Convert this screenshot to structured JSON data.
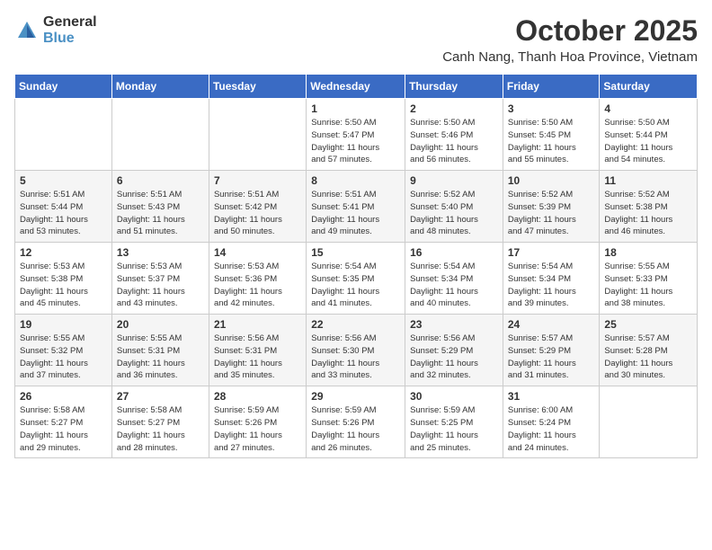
{
  "header": {
    "logo_general": "General",
    "logo_blue": "Blue",
    "month": "October 2025",
    "location": "Canh Nang, Thanh Hoa Province, Vietnam"
  },
  "weekdays": [
    "Sunday",
    "Monday",
    "Tuesday",
    "Wednesday",
    "Thursday",
    "Friday",
    "Saturday"
  ],
  "weeks": [
    [
      {
        "day": "",
        "info": ""
      },
      {
        "day": "",
        "info": ""
      },
      {
        "day": "",
        "info": ""
      },
      {
        "day": "1",
        "info": "Sunrise: 5:50 AM\nSunset: 5:47 PM\nDaylight: 11 hours\nand 57 minutes."
      },
      {
        "day": "2",
        "info": "Sunrise: 5:50 AM\nSunset: 5:46 PM\nDaylight: 11 hours\nand 56 minutes."
      },
      {
        "day": "3",
        "info": "Sunrise: 5:50 AM\nSunset: 5:45 PM\nDaylight: 11 hours\nand 55 minutes."
      },
      {
        "day": "4",
        "info": "Sunrise: 5:50 AM\nSunset: 5:44 PM\nDaylight: 11 hours\nand 54 minutes."
      }
    ],
    [
      {
        "day": "5",
        "info": "Sunrise: 5:51 AM\nSunset: 5:44 PM\nDaylight: 11 hours\nand 53 minutes."
      },
      {
        "day": "6",
        "info": "Sunrise: 5:51 AM\nSunset: 5:43 PM\nDaylight: 11 hours\nand 51 minutes."
      },
      {
        "day": "7",
        "info": "Sunrise: 5:51 AM\nSunset: 5:42 PM\nDaylight: 11 hours\nand 50 minutes."
      },
      {
        "day": "8",
        "info": "Sunrise: 5:51 AM\nSunset: 5:41 PM\nDaylight: 11 hours\nand 49 minutes."
      },
      {
        "day": "9",
        "info": "Sunrise: 5:52 AM\nSunset: 5:40 PM\nDaylight: 11 hours\nand 48 minutes."
      },
      {
        "day": "10",
        "info": "Sunrise: 5:52 AM\nSunset: 5:39 PM\nDaylight: 11 hours\nand 47 minutes."
      },
      {
        "day": "11",
        "info": "Sunrise: 5:52 AM\nSunset: 5:38 PM\nDaylight: 11 hours\nand 46 minutes."
      }
    ],
    [
      {
        "day": "12",
        "info": "Sunrise: 5:53 AM\nSunset: 5:38 PM\nDaylight: 11 hours\nand 45 minutes."
      },
      {
        "day": "13",
        "info": "Sunrise: 5:53 AM\nSunset: 5:37 PM\nDaylight: 11 hours\nand 43 minutes."
      },
      {
        "day": "14",
        "info": "Sunrise: 5:53 AM\nSunset: 5:36 PM\nDaylight: 11 hours\nand 42 minutes."
      },
      {
        "day": "15",
        "info": "Sunrise: 5:54 AM\nSunset: 5:35 PM\nDaylight: 11 hours\nand 41 minutes."
      },
      {
        "day": "16",
        "info": "Sunrise: 5:54 AM\nSunset: 5:34 PM\nDaylight: 11 hours\nand 40 minutes."
      },
      {
        "day": "17",
        "info": "Sunrise: 5:54 AM\nSunset: 5:34 PM\nDaylight: 11 hours\nand 39 minutes."
      },
      {
        "day": "18",
        "info": "Sunrise: 5:55 AM\nSunset: 5:33 PM\nDaylight: 11 hours\nand 38 minutes."
      }
    ],
    [
      {
        "day": "19",
        "info": "Sunrise: 5:55 AM\nSunset: 5:32 PM\nDaylight: 11 hours\nand 37 minutes."
      },
      {
        "day": "20",
        "info": "Sunrise: 5:55 AM\nSunset: 5:31 PM\nDaylight: 11 hours\nand 36 minutes."
      },
      {
        "day": "21",
        "info": "Sunrise: 5:56 AM\nSunset: 5:31 PM\nDaylight: 11 hours\nand 35 minutes."
      },
      {
        "day": "22",
        "info": "Sunrise: 5:56 AM\nSunset: 5:30 PM\nDaylight: 11 hours\nand 33 minutes."
      },
      {
        "day": "23",
        "info": "Sunrise: 5:56 AM\nSunset: 5:29 PM\nDaylight: 11 hours\nand 32 minutes."
      },
      {
        "day": "24",
        "info": "Sunrise: 5:57 AM\nSunset: 5:29 PM\nDaylight: 11 hours\nand 31 minutes."
      },
      {
        "day": "25",
        "info": "Sunrise: 5:57 AM\nSunset: 5:28 PM\nDaylight: 11 hours\nand 30 minutes."
      }
    ],
    [
      {
        "day": "26",
        "info": "Sunrise: 5:58 AM\nSunset: 5:27 PM\nDaylight: 11 hours\nand 29 minutes."
      },
      {
        "day": "27",
        "info": "Sunrise: 5:58 AM\nSunset: 5:27 PM\nDaylight: 11 hours\nand 28 minutes."
      },
      {
        "day": "28",
        "info": "Sunrise: 5:59 AM\nSunset: 5:26 PM\nDaylight: 11 hours\nand 27 minutes."
      },
      {
        "day": "29",
        "info": "Sunrise: 5:59 AM\nSunset: 5:26 PM\nDaylight: 11 hours\nand 26 minutes."
      },
      {
        "day": "30",
        "info": "Sunrise: 5:59 AM\nSunset: 5:25 PM\nDaylight: 11 hours\nand 25 minutes."
      },
      {
        "day": "31",
        "info": "Sunrise: 6:00 AM\nSunset: 5:24 PM\nDaylight: 11 hours\nand 24 minutes."
      },
      {
        "day": "",
        "info": ""
      }
    ]
  ]
}
